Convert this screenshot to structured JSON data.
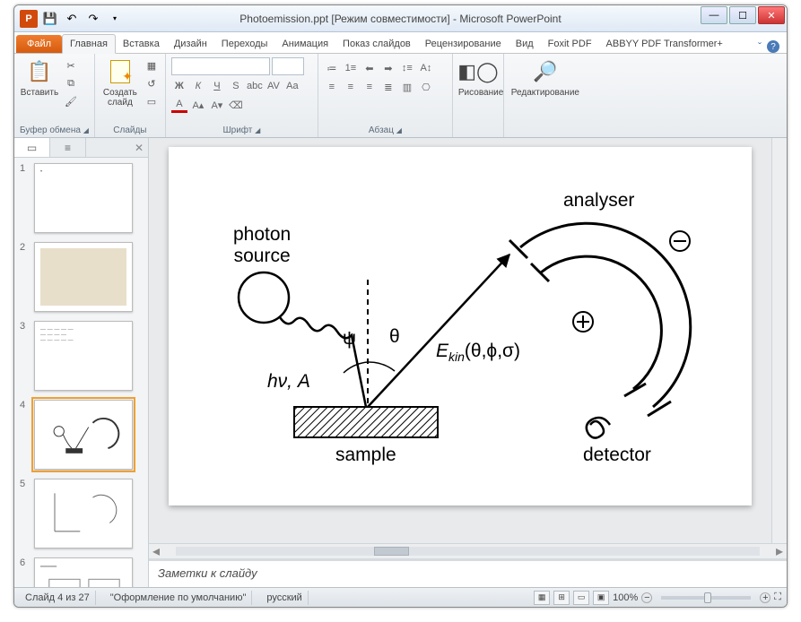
{
  "titlebar": {
    "app_icon": "P",
    "title": "Photoemission.ppt  [Режим совместимости]  -  Microsoft PowerPoint"
  },
  "ribbon_tabs": {
    "file": "Файл",
    "items": [
      "Главная",
      "Вставка",
      "Дизайн",
      "Переходы",
      "Анимация",
      "Показ слайдов",
      "Рецензирование",
      "Вид",
      "Foxit PDF",
      "ABBYY PDF Transformer+"
    ],
    "active_index": 0
  },
  "ribbon": {
    "clipboard": {
      "paste": "Вставить",
      "label": "Буфер обмена"
    },
    "slides": {
      "new_slide": "Создать\nслайд",
      "label": "Слайды"
    },
    "font": {
      "label": "Шрифт"
    },
    "paragraph": {
      "label": "Абзац"
    },
    "drawing": {
      "label": "Рисование"
    },
    "editing": {
      "label": "Редактирование"
    }
  },
  "thumbs": {
    "count": 6,
    "selected": 4
  },
  "slide": {
    "labels": {
      "photon_source": "photon\nsource",
      "analyser": "analyser",
      "psi": "ψ",
      "theta": "θ",
      "hv": "hν, A",
      "ekin": "E",
      "ekin_sub": "kin",
      "ekin_args": "(θ,ϕ,σ)",
      "sample": "sample",
      "detector": "detector"
    }
  },
  "notes": {
    "placeholder": "Заметки к слайду"
  },
  "status": {
    "slide_pos": "Слайд 4 из 27",
    "theme": "\"Оформление по умолчанию\"",
    "lang": "русский",
    "zoom": "100%"
  }
}
